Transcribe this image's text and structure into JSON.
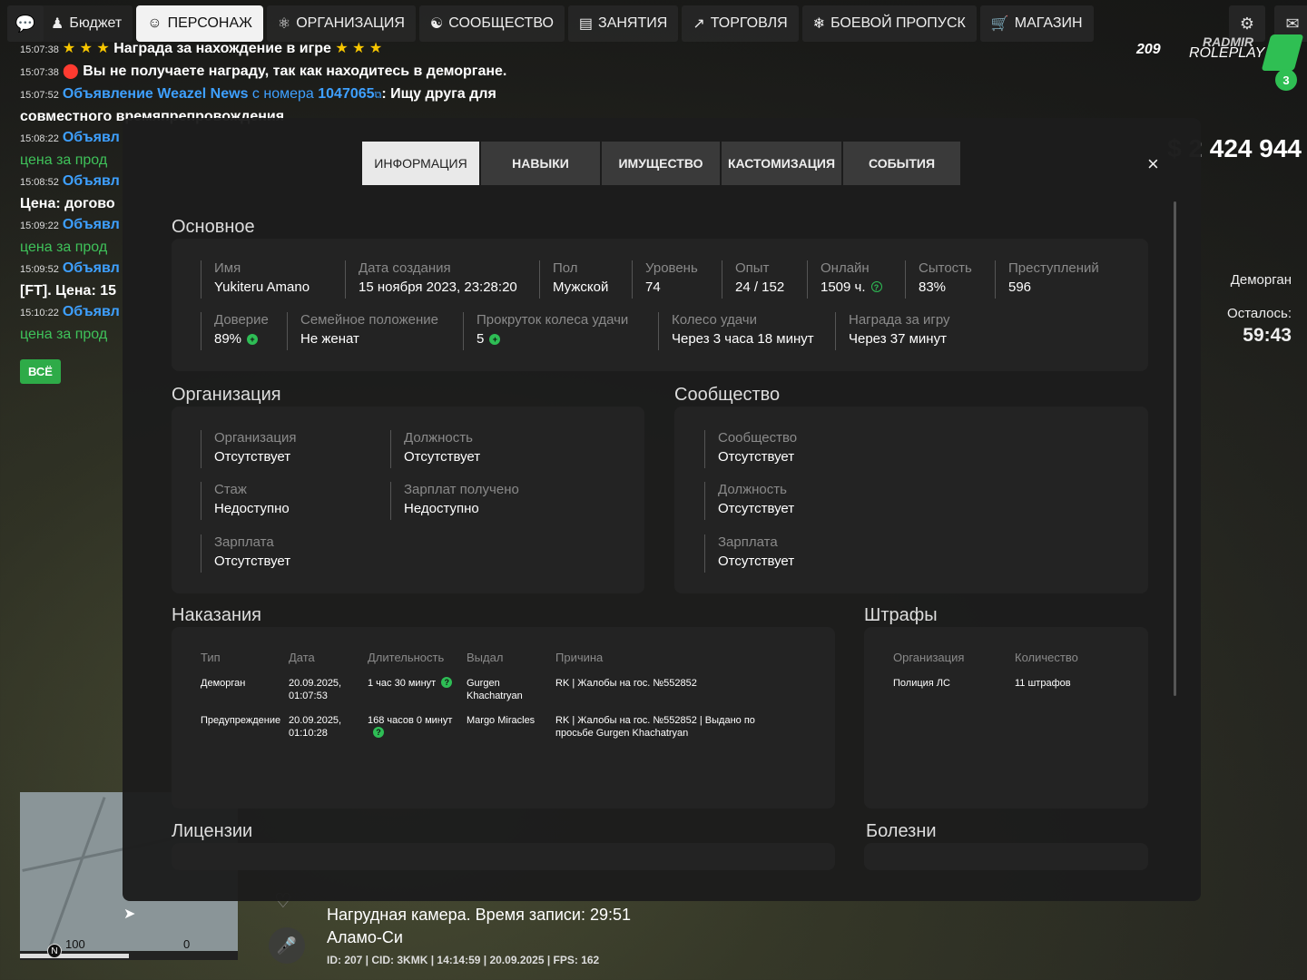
{
  "nav": {
    "budget": "Бюджет",
    "items": [
      {
        "label": "ПЕРСОНАЖ",
        "icon": "user-icon",
        "active": true
      },
      {
        "label": "ОРГАНИЗАЦИЯ",
        "icon": "organization-icon"
      },
      {
        "label": "СООБЩЕСТВО",
        "icon": "community-icon"
      },
      {
        "label": "ЗАНЯТИЯ",
        "icon": "notebook-icon"
      },
      {
        "label": "ТОРГОВЛЯ",
        "icon": "chart-icon"
      },
      {
        "label": "БОЕВОЙ ПРОПУСК",
        "icon": "snowflake-icon"
      },
      {
        "label": "МАГАЗИН",
        "icon": "cart-icon"
      }
    ]
  },
  "logo": {
    "server_num": "209",
    "brand_top": "RADMIR",
    "brand": "ROLEPLAY",
    "badge": "3"
  },
  "chat": {
    "l1_ts": "15:07:38",
    "l1_text": "Награда за нахождение в игре",
    "l2_ts": "15:07:38",
    "l2_text": "Вы не получаете награду, так как находитесь в деморгане.",
    "l3_ts": "15:07:52",
    "l3_ad": "Объявление Weazel News",
    "l3_from": "с номера",
    "l3_num": "1047065",
    "l3_text": ": Ищу друга для",
    "l3_cont": "совместного времяпрепровождения",
    "l4_ts": "15:08:22",
    "l4_ad": "Объявл",
    "l4_cont": "цена за прод",
    "l5_ts": "15:08:52",
    "l5_ad": "Объявл",
    "l5_cont": "Цена: догово",
    "l6_ts": "15:09:22",
    "l6_ad": "Объявл",
    "l6_cont": "цена за прод",
    "l7_ts": "15:09:52",
    "l7_ad": "Объявл",
    "l7_cont": "[FT]. Цена: 15",
    "l8_ts": "15:10:22",
    "l8_ad": "Объявл",
    "l8_cont": "цена за прод",
    "all": "ВСЁ"
  },
  "money": {
    "prefix": "$ 2",
    "value": "424 944"
  },
  "side": {
    "status": "Деморган",
    "left_label": "Осталось:",
    "left_value": "59:43"
  },
  "minimap": {
    "scale_a": "100",
    "scale_b": "0",
    "north": "N"
  },
  "hud": {
    "cam": "Нагрудная камера. Время записи: 29:51",
    "location": "Аламо-Си",
    "info": "ID: 207 | CID: 3KMK | 14:14:59   | 20.09.2025 | FPS: 162"
  },
  "modal": {
    "tabs": [
      "ИНФОРМАЦИЯ",
      "НАВЫКИ",
      "ИМУЩЕСТВО",
      "КАСТОМИЗАЦИЯ",
      "СОБЫТИЯ"
    ],
    "close": "×",
    "basic": {
      "title": "Основное",
      "name_l": "Имя",
      "name_v": "Yukiteru Amano",
      "created_l": "Дата создания",
      "created_v": "15 ноября 2023, 23:28:20",
      "sex_l": "Пол",
      "sex_v": "Мужской",
      "level_l": "Уровень",
      "level_v": "74",
      "exp_l": "Опыт",
      "exp_v": "24 / 152",
      "online_l": "Онлайн",
      "online_v": "1509 ч.",
      "sat_l": "Сытость",
      "sat_v": "83%",
      "crimes_l": "Преступлений",
      "crimes_v": "596",
      "trust_l": "Доверие",
      "trust_v": "89%",
      "family_l": "Семейное положение",
      "family_v": "Не женат",
      "spins_l": "Прокруток колеса удачи",
      "spins_v": "5",
      "wheel_l": "Колесо удачи",
      "wheel_v": "Через 3 часа 18 минут",
      "reward_l": "Награда за игру",
      "reward_v": "Через 37 минут"
    },
    "org": {
      "title": "Организация",
      "org_l": "Организация",
      "org_v": "Отсутствует",
      "pos_l": "Должность",
      "pos_v": "Отсутствует",
      "exp_l": "Стаж",
      "exp_v": "Недоступно",
      "paid_l": "Зарплат получено",
      "paid_v": "Недоступно",
      "sal_l": "Зарплата",
      "sal_v": "Отсутствует"
    },
    "comm": {
      "title": "Сообщество",
      "c_l": "Сообщество",
      "c_v": "Отсутствует",
      "pos_l": "Должность",
      "pos_v": "Отсутствует",
      "sal_l": "Зарплата",
      "sal_v": "Отсутствует"
    },
    "pun": {
      "title": "Наказания",
      "cols": [
        "Тип",
        "Дата",
        "Длительность",
        "Выдал",
        "Причина"
      ],
      "r1": {
        "type": "Деморган",
        "date": "20.09.2025,",
        "time": "01:07:53",
        "dur": "1 час 30 минут",
        "by1": "Gurgen",
        "by2": "Khachatryan",
        "reason": "RK | Жалобы на гос. №552852"
      },
      "r2": {
        "type": "Предупреждение",
        "date": "20.09.2025,",
        "time": "01:10:28",
        "dur": "168 часов 0 минут",
        "by1": "Margo Miracles",
        "reason1": "RK | Жалобы на гос. №552852 | Выдано по",
        "reason2": "просьбе Gurgen Khachatryan"
      }
    },
    "fines": {
      "title": "Штрафы",
      "cols": [
        "Организация",
        "Количество"
      ],
      "org": "Полиция ЛС",
      "count": "11 штрафов"
    },
    "lic": {
      "title": "Лицензии"
    },
    "ill": {
      "title": "Болезни"
    }
  }
}
